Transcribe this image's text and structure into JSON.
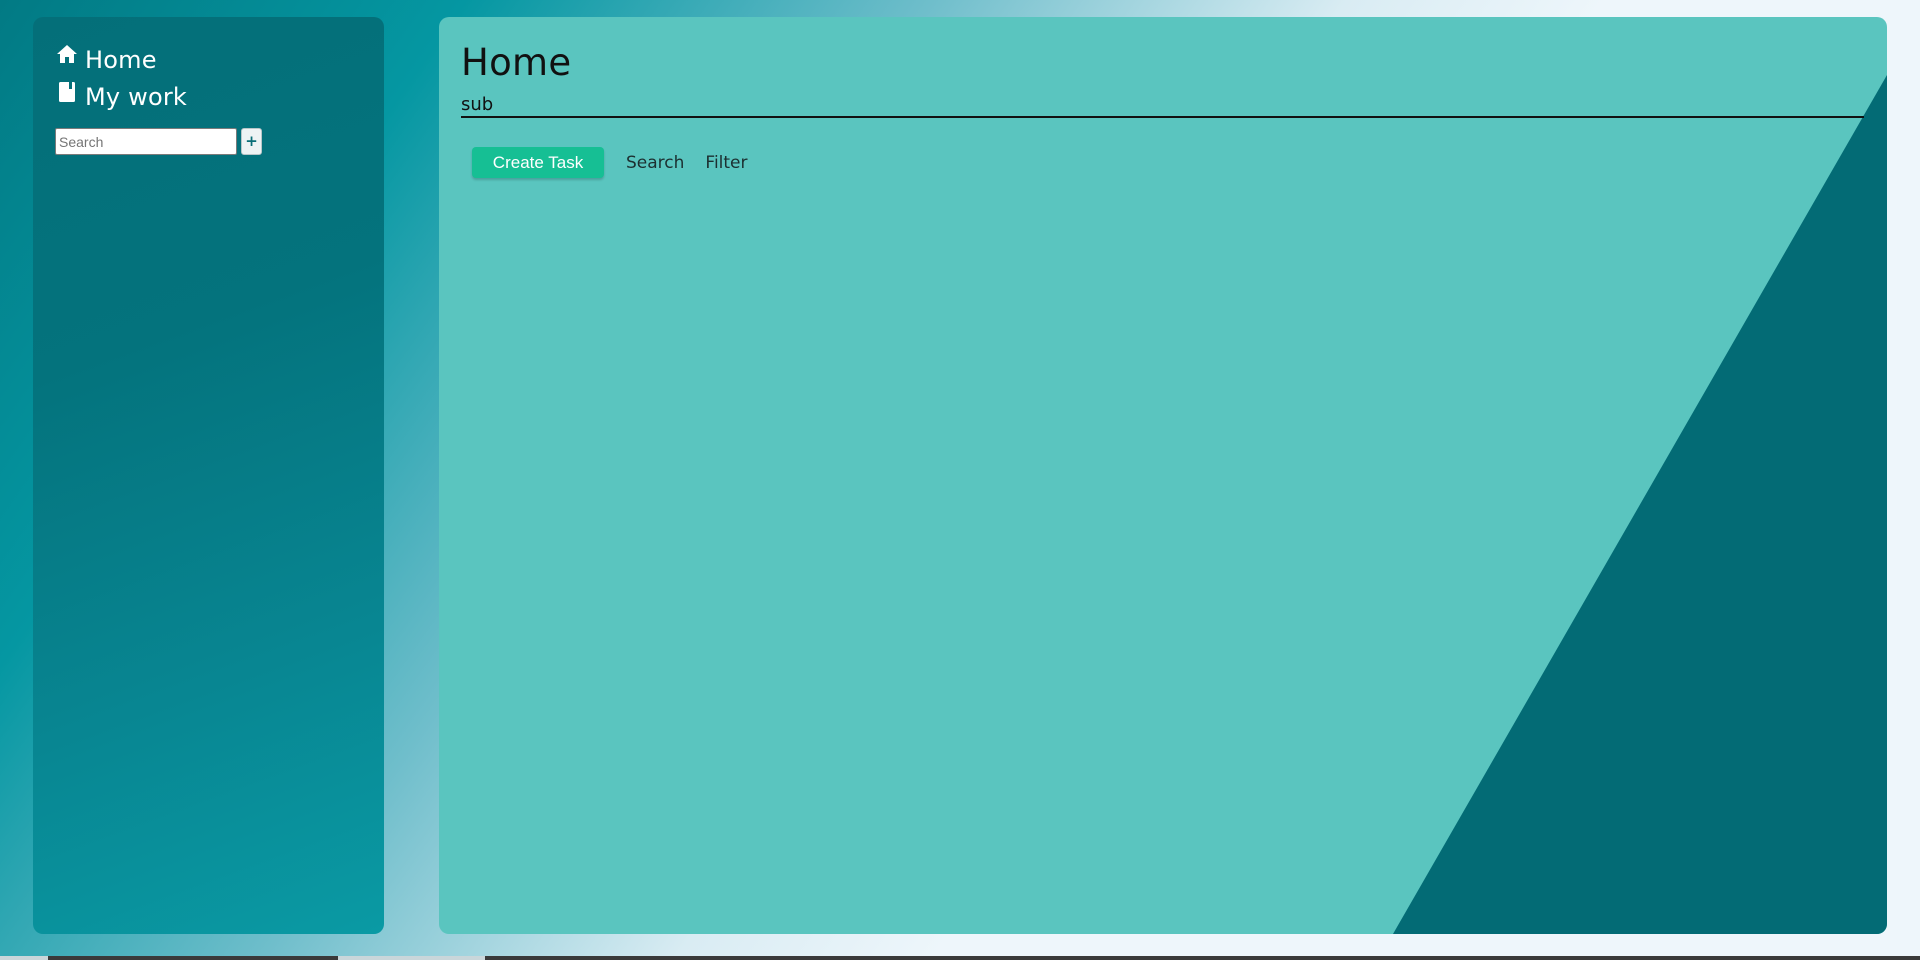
{
  "sidebar": {
    "items": [
      {
        "label": "Home",
        "icon": "home-icon"
      },
      {
        "label": "My work",
        "icon": "book-icon"
      }
    ],
    "search": {
      "placeholder": "Search",
      "value": ""
    },
    "add_label": "+"
  },
  "main": {
    "title": "Home",
    "subtitle_value": "sub",
    "actions": {
      "create_label": "Create Task",
      "search_label": "Search",
      "filter_label": "Filter"
    }
  },
  "colors": {
    "sidebar_bg": "#046f79",
    "main_bg": "#5ac5bf",
    "main_accent_dark": "#036b75",
    "create_button": "#16bf94"
  }
}
